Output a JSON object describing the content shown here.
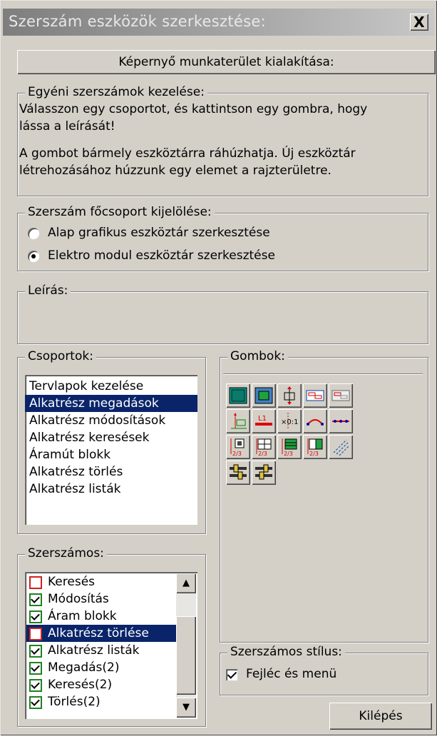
{
  "window": {
    "title": "Szerszám eszközök szerkesztése:",
    "close_label": "X"
  },
  "workspace_button": "Képernyő munkaterület kialakítása:",
  "custom_tools": {
    "legend": "Egyéni szerszámok kezelése:",
    "line1": "Válasszon egy csoportot, és kattintson egy gombra, hogy",
    "line2": "lássa a leírását!",
    "line3": "A gombot bármely eszköztárra ráhúzhatja. Új eszköztár",
    "line4": "létrehozásához húzzunk egy elemet a rajzterületre."
  },
  "main_group": {
    "legend": "Szerszám főcsoport kijelölése:",
    "options": [
      {
        "label": "Alap grafikus eszköztár szerkesztése",
        "selected": false
      },
      {
        "label": "Elektro modul eszköztár szerkesztése",
        "selected": true
      }
    ]
  },
  "description": {
    "legend": "Leírás:"
  },
  "groups": {
    "legend": "Csoportok:",
    "items": [
      "Tervlapok kezelése",
      "Alkatrész megadások",
      "Alkatrész módosítások",
      "Alkatrész keresések",
      "Áramút blokk",
      "Alkatrész törlés",
      "Alkatrész listák"
    ],
    "selected_index": 1
  },
  "buttons_panel": {
    "legend": "Gombok:",
    "tool_icons": [
      "green-rect-icon",
      "green-rect-frame-icon",
      "move-vertical-icon",
      "window-blue-icon",
      "window-gray-icon",
      "axis-move-icon",
      "l1-red-line-icon",
      "x-ratio-icon",
      "arc-icon",
      "dotted-line-icon",
      "ratio-23-icon",
      "ratio-23-grid-icon",
      "ratio-23-green-icon",
      "ratio-23-green-grid-icon",
      "diagonal-lines-icon",
      "slider-left-icon",
      "slider-right-icon"
    ]
  },
  "toolbars": {
    "legend": "Szerszámos:",
    "items": [
      {
        "label": "Keresés",
        "checked": false,
        "selected": false
      },
      {
        "label": "Módosítás",
        "checked": true,
        "selected": false
      },
      {
        "label": "Áram blokk",
        "checked": true,
        "selected": false
      },
      {
        "label": "Alkatrész törlése",
        "checked": false,
        "selected": true
      },
      {
        "label": "Alkatrész listák",
        "checked": true,
        "selected": false
      },
      {
        "label": "Megadás(2)",
        "checked": true,
        "selected": false
      },
      {
        "label": "Keresés(2)",
        "checked": true,
        "selected": false
      },
      {
        "label": "Törlés(2)",
        "checked": true,
        "selected": false
      }
    ]
  },
  "style": {
    "legend": "Szerszámos stílus:",
    "option_label": "Fejléc és menü",
    "checked": true
  },
  "exit_button": "Kilépés",
  "colors": {
    "selection": "#0a246a",
    "dialog": "#d4d0c8"
  }
}
